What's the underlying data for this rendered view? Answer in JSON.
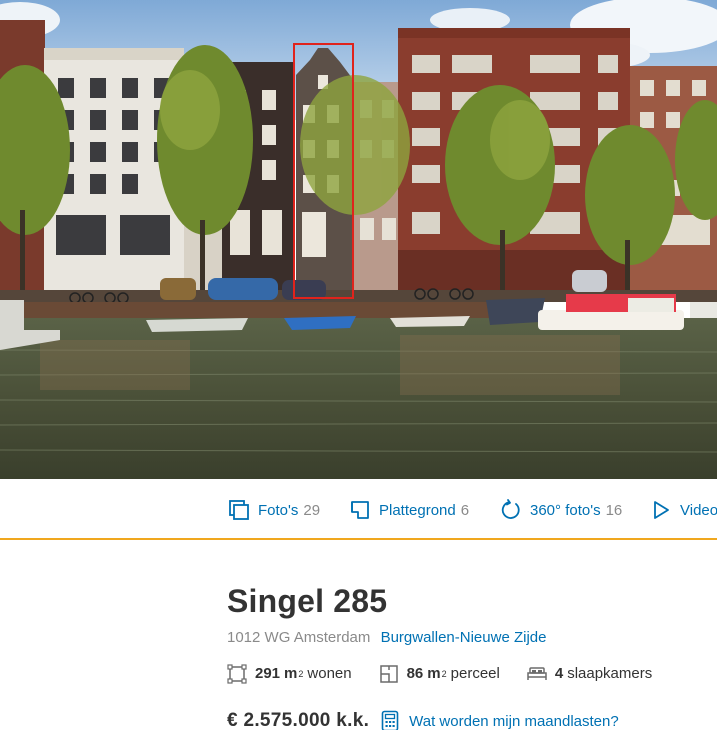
{
  "hero": {
    "image_alt": "Canal houses along Singel with a building highlighted in red"
  },
  "media_nav": {
    "fotos": {
      "label": "Foto's",
      "count": "29",
      "icon": "photos-icon"
    },
    "plattegrond": {
      "label": "Plattegrond",
      "count": "6",
      "icon": "floorplan-icon"
    },
    "foto360": {
      "label": "360° foto's",
      "count": "16",
      "icon": "360-icon"
    },
    "video": {
      "label": "Video",
      "icon": "play-icon"
    }
  },
  "listing": {
    "title": "Singel 285",
    "address": "1012 WG Amsterdam",
    "neighborhood": "Burgwallen-Nieuwe Zijde",
    "living_area_value": "291",
    "living_area_unit": "m",
    "living_area_sup": "2",
    "living_area_label": "wonen",
    "plot_value": "86",
    "plot_unit": "m",
    "plot_sup": "2",
    "plot_label": "perceel",
    "bedrooms_value": "4",
    "bedrooms_label": "slaapkamers",
    "price": "€ 2.575.000 k.k.",
    "monthly_costs_link": "Wat worden mijn maandlasten?"
  },
  "colors": {
    "link": "#0071b3",
    "accent": "#f0a71e",
    "text": "#333333",
    "muted": "#8a8a8a",
    "highlight": "#e0231c"
  }
}
